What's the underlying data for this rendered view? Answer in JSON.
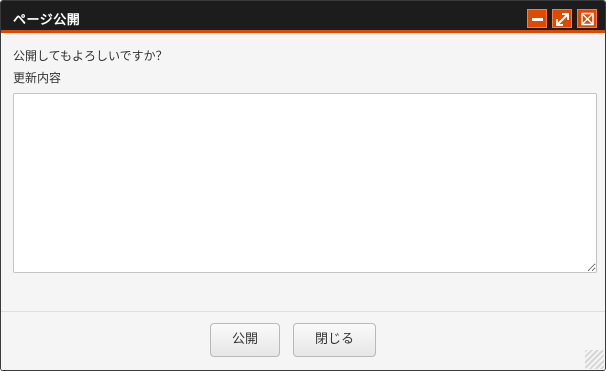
{
  "window": {
    "title": "ページ公開",
    "controls": {
      "minimize_icon": "minimize-icon",
      "maximize_icon": "maximize-icon",
      "close_icon": "close-icon"
    }
  },
  "body": {
    "prompt": "公開してもよろしいですか？",
    "field_label": "更新内容",
    "textarea_value": ""
  },
  "footer": {
    "publish_label": "公開",
    "close_label": "閉じる"
  },
  "colors": {
    "accent": "#e04a00",
    "titlebar": "#1c1c1c"
  }
}
